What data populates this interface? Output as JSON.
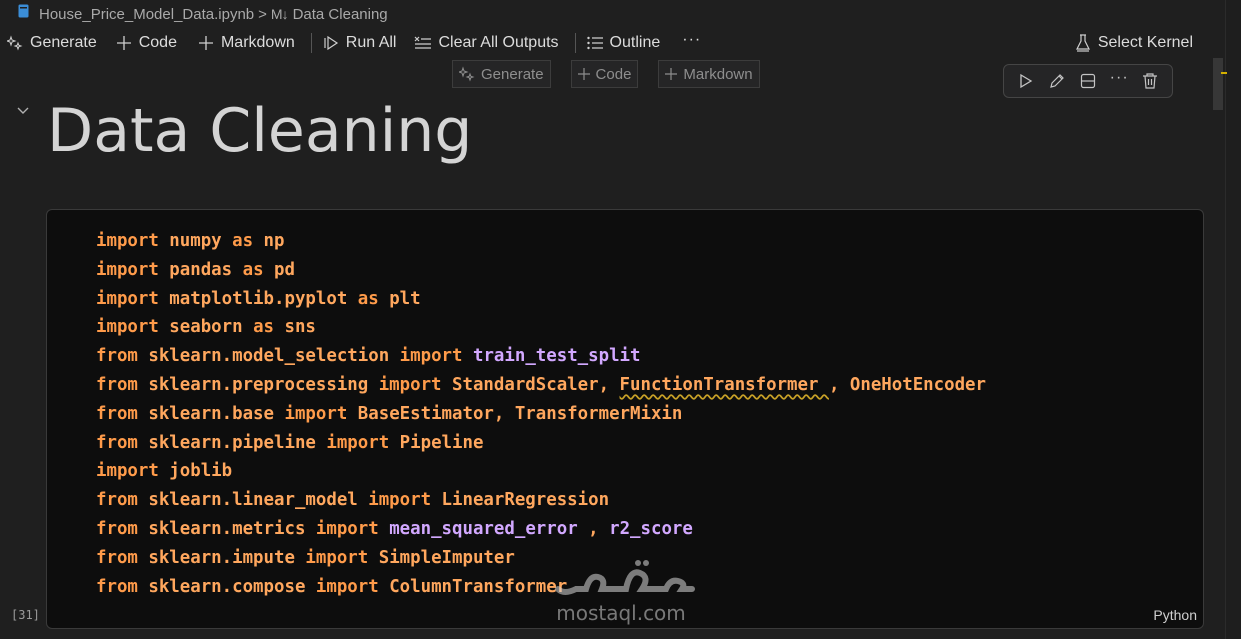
{
  "breadcrumb": {
    "file": "House_Price_Model_Data.ipynb",
    "separator": ">",
    "md_icon": "M↓",
    "section": "Data Cleaning"
  },
  "toolbar": {
    "generate": "Generate",
    "code": "Code",
    "markdown": "Markdown",
    "run_all": "Run All",
    "clear_outputs": "Clear All Outputs",
    "outline": "Outline",
    "more": "···",
    "select_kernel": "Select Kernel"
  },
  "insert_bar": {
    "generate": "Generate",
    "code": "Code",
    "markdown": "Markdown"
  },
  "cell_toolbar": {
    "more": "···"
  },
  "markdown_cell": {
    "heading": "Data Cleaning"
  },
  "code_cell": {
    "execution_count": "[31]",
    "language": "Python",
    "lines": [
      [
        {
          "t": "import",
          "c": "kw"
        },
        {
          "t": " numpy ",
          "c": "id"
        },
        {
          "t": "as",
          "c": "kw"
        },
        {
          "t": " np",
          "c": "id"
        }
      ],
      [
        {
          "t": "import",
          "c": "kw"
        },
        {
          "t": " pandas ",
          "c": "id"
        },
        {
          "t": "as",
          "c": "kw"
        },
        {
          "t": " pd",
          "c": "id"
        }
      ],
      [
        {
          "t": "import",
          "c": "kw"
        },
        {
          "t": " matplotlib.pyplot ",
          "c": "id"
        },
        {
          "t": "as",
          "c": "kw"
        },
        {
          "t": " plt",
          "c": "id"
        }
      ],
      [
        {
          "t": "import",
          "c": "kw"
        },
        {
          "t": " seaborn ",
          "c": "id"
        },
        {
          "t": "as",
          "c": "kw"
        },
        {
          "t": " sns",
          "c": "id"
        }
      ],
      [
        {
          "t": "from",
          "c": "kw"
        },
        {
          "t": " sklearn.model_selection ",
          "c": "id"
        },
        {
          "t": "import",
          "c": "kw"
        },
        {
          "t": " ",
          "c": "id"
        },
        {
          "t": "train_test_split",
          "c": "fn"
        }
      ],
      [
        {
          "t": "from",
          "c": "kw"
        },
        {
          "t": " sklearn.preprocessing ",
          "c": "id"
        },
        {
          "t": "import",
          "c": "kw"
        },
        {
          "t": " StandardScaler, ",
          "c": "id"
        },
        {
          "t": "FunctionTransformer ",
          "c": "id warn"
        },
        {
          "t": ", OneHotEncoder",
          "c": "id"
        }
      ],
      [
        {
          "t": "from",
          "c": "kw"
        },
        {
          "t": " sklearn.base ",
          "c": "id"
        },
        {
          "t": "import",
          "c": "kw"
        },
        {
          "t": " BaseEstimator, TransformerMixin",
          "c": "id"
        }
      ],
      [
        {
          "t": "from",
          "c": "kw"
        },
        {
          "t": " sklearn.pipeline ",
          "c": "id"
        },
        {
          "t": "import",
          "c": "kw"
        },
        {
          "t": " Pipeline",
          "c": "id"
        }
      ],
      [
        {
          "t": "import",
          "c": "kw"
        },
        {
          "t": " joblib",
          "c": "id"
        }
      ],
      [
        {
          "t": "from",
          "c": "kw"
        },
        {
          "t": " sklearn.linear_model ",
          "c": "id"
        },
        {
          "t": "import",
          "c": "kw"
        },
        {
          "t": " LinearRegression",
          "c": "id"
        }
      ],
      [
        {
          "t": "from",
          "c": "kw"
        },
        {
          "t": " sklearn.metrics ",
          "c": "id"
        },
        {
          "t": "import",
          "c": "kw"
        },
        {
          "t": " ",
          "c": "id"
        },
        {
          "t": "mean_squared_error",
          "c": "fn"
        },
        {
          "t": " , ",
          "c": "id"
        },
        {
          "t": "r2_score",
          "c": "fn"
        }
      ],
      [
        {
          "t": "from",
          "c": "kw"
        },
        {
          "t": " sklearn.impute ",
          "c": "id"
        },
        {
          "t": "import",
          "c": "kw"
        },
        {
          "t": " SimpleImputer",
          "c": "id"
        }
      ],
      [
        {
          "t": "from",
          "c": "kw"
        },
        {
          "t": " sklearn.compose ",
          "c": "id"
        },
        {
          "t": "import",
          "c": "kw"
        },
        {
          "t": " ColumnTransformer",
          "c": "id"
        }
      ]
    ]
  },
  "watermark": {
    "arabic": "مستقل",
    "text": "mostaql.com"
  },
  "colors": {
    "background": "#1f1f1f",
    "code_background": "#0d0d0d",
    "keyword": "#ff9b4a",
    "function": "#d2a8ff",
    "warning_underline": "#c9a227"
  }
}
